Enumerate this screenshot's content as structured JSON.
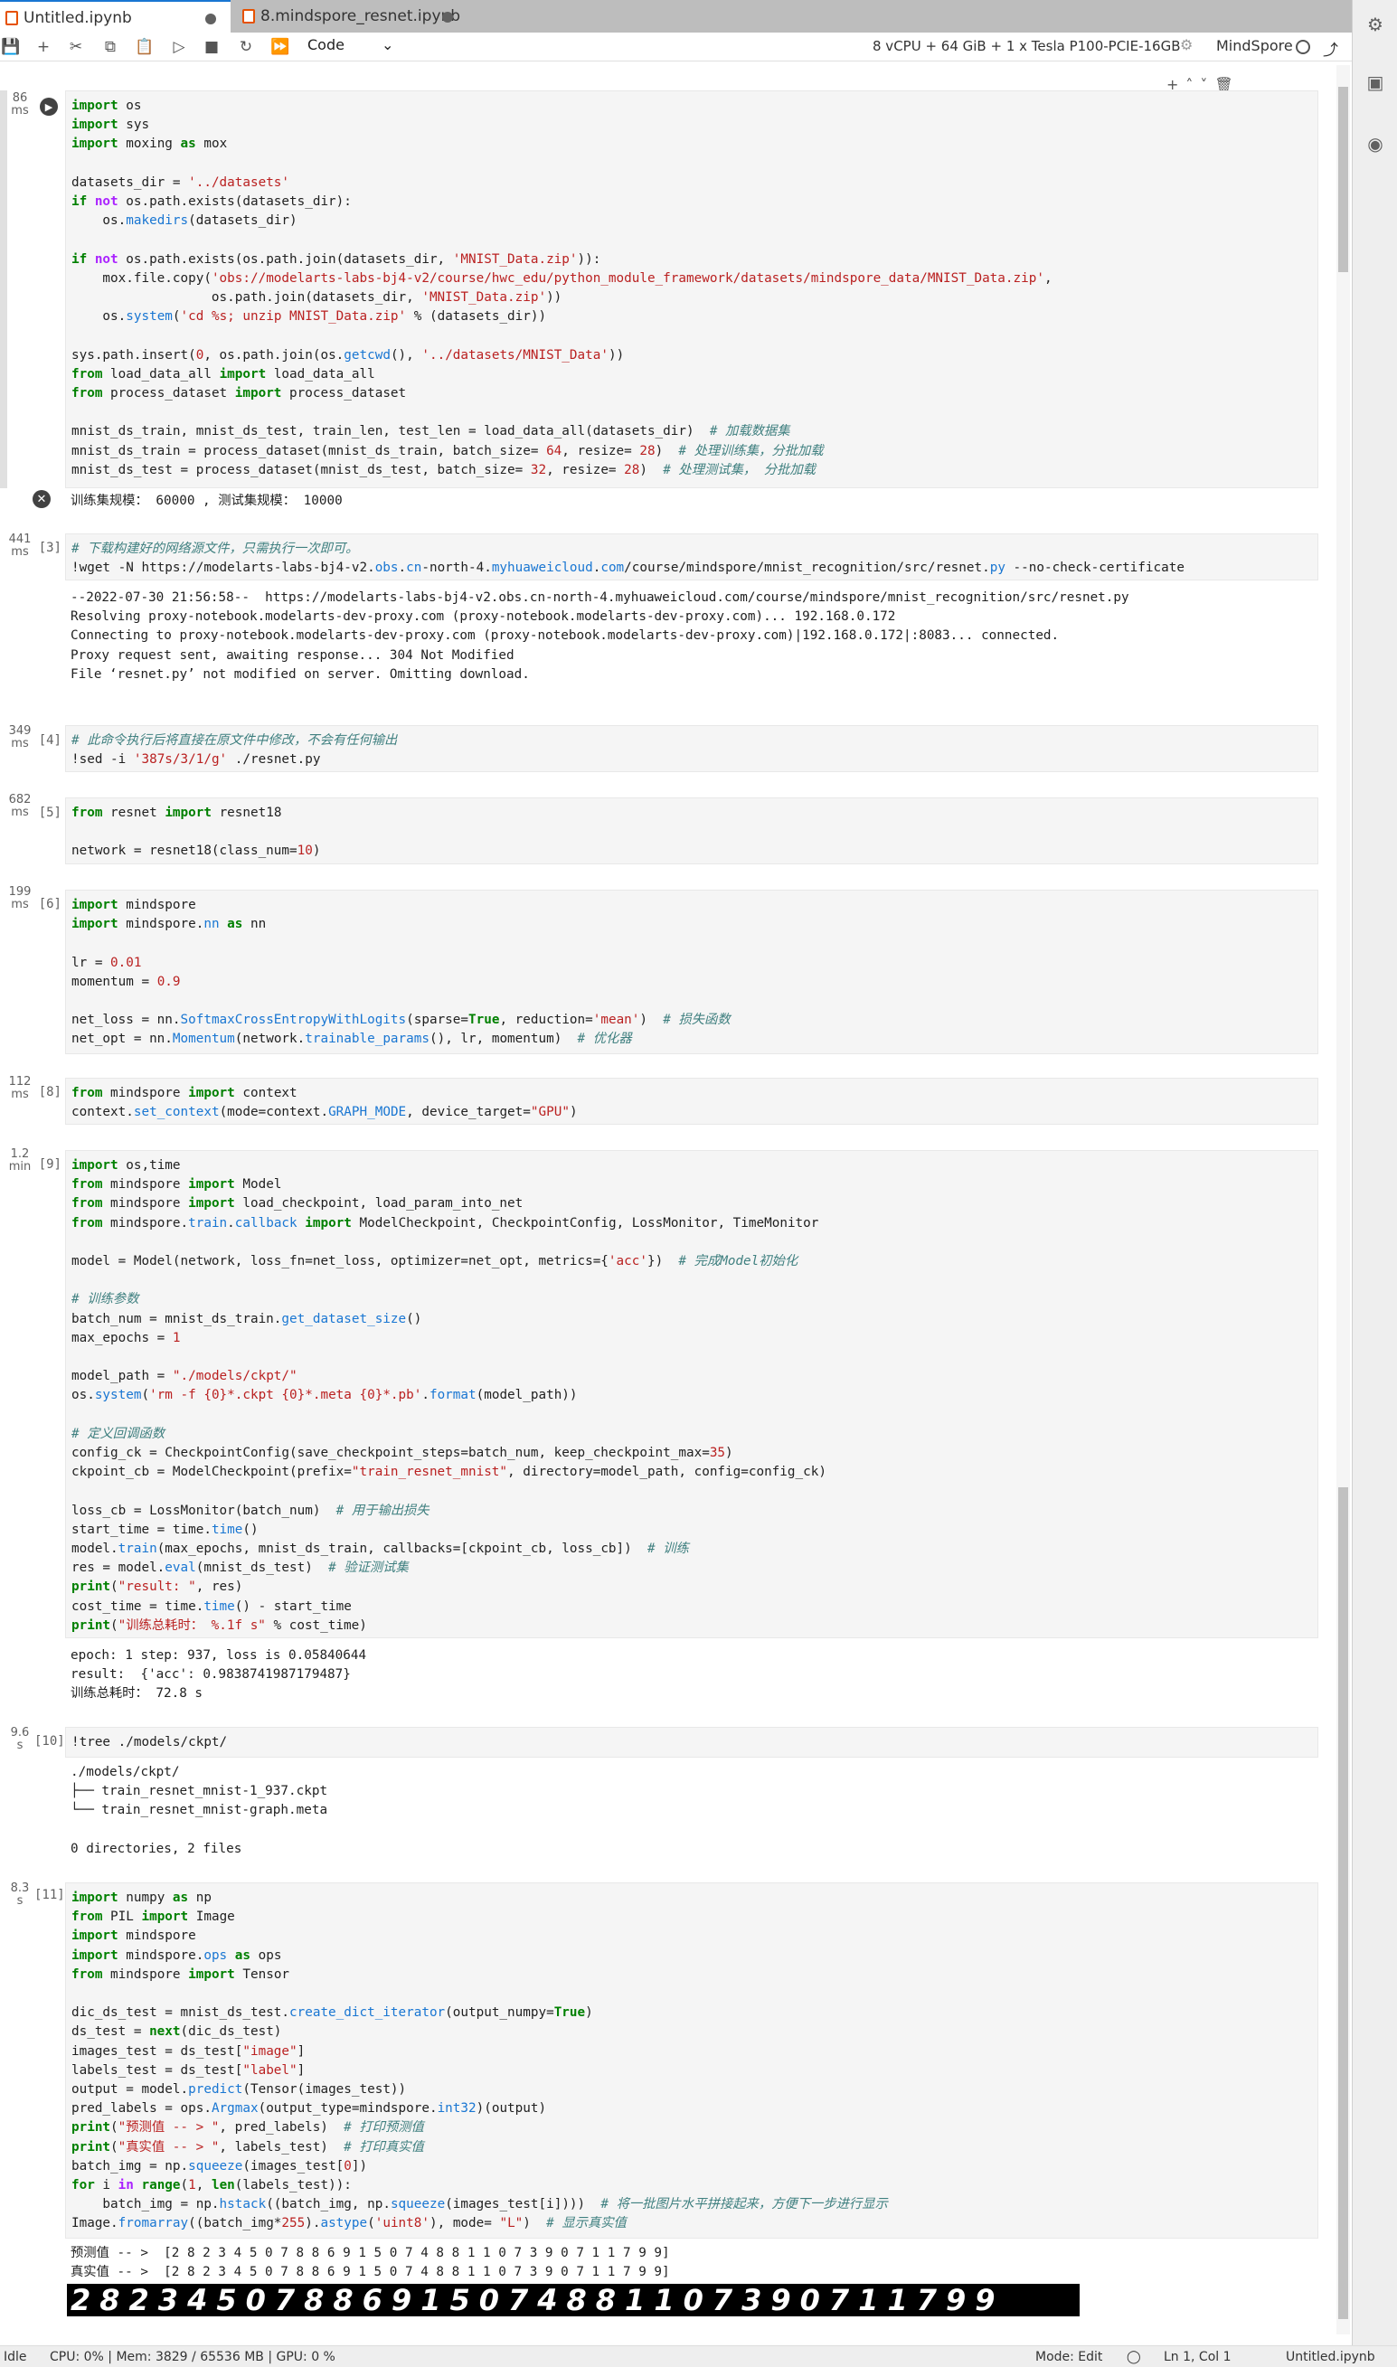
{
  "tabs": [
    {
      "label": "Untitled.ipynb",
      "active": true
    },
    {
      "label": "8.mindspore_resnet.ipynb",
      "active": false
    }
  ],
  "toolbar": {
    "cell_type": "Code",
    "kernel_info": "8 vCPU + 64 GiB + 1 x Tesla P100-PCIE-16GB",
    "kernel_name": "MindSpore"
  },
  "cells": [
    {
      "time": "86\nms",
      "prompt": "",
      "running": true
    },
    {
      "time": "441\nms",
      "prompt": "[3]"
    },
    {
      "time": "349\nms",
      "prompt": "[4]"
    },
    {
      "time": "682\nms",
      "prompt": "[5]"
    },
    {
      "time": "199\nms",
      "prompt": "[6]"
    },
    {
      "time": "112\nms",
      "prompt": "[8]"
    },
    {
      "time": "1.2\nmin",
      "prompt": "[9]"
    },
    {
      "time": "9.6\ns",
      "prompt": "[10]"
    },
    {
      "time": "8.3\ns",
      "prompt": "[11]"
    }
  ],
  "outputs": {
    "o1": "训练集规模： 60000 , 测试集规模： 10000",
    "o3_lines": [
      "--2022-07-30 21:56:58--  https://modelarts-labs-bj4-v2.obs.cn-north-4.myhuaweicloud.com/course/mindspore/mnist_recognition/src/resnet.py",
      "Resolving proxy-notebook.modelarts-dev-proxy.com (proxy-notebook.modelarts-dev-proxy.com)... 192.168.0.172",
      "Connecting to proxy-notebook.modelarts-dev-proxy.com (proxy-notebook.modelarts-dev-proxy.com)|192.168.0.172|:8083... connected.",
      "Proxy request sent, awaiting response... 304 Not Modified",
      "File ‘resnet.py’ not modified on server. Omitting download."
    ],
    "o9_lines": [
      "epoch: 1 step: 937, loss is 0.05840644",
      "result:  {'acc': 0.9838741987179487}",
      "训练总耗时： 72.8 s"
    ],
    "o10_lines": [
      "./models/ckpt/",
      "├── train_resnet_mnist-1_937.ckpt",
      "└── train_resnet_mnist-graph.meta",
      "",
      "0 directories, 2 files"
    ],
    "o11_lines": [
      "预测值 -- >  [2 8 2 3 4 5 0 7 8 8 6 9 1 5 0 7 4 8 8 1 1 0 7 3 9 0 7 1 1 7 9 9]",
      "真实值 -- >  [2 8 2 3 4 5 0 7 8 8 6 9 1 5 0 7 4 8 8 1 1 0 7 3 9 0 7 1 1 7 9 9]"
    ],
    "digits": "28234507886915074881107390711799"
  },
  "status": {
    "mode_idle": "Idle",
    "resources": "CPU: 0% | Mem: 3829 / 65536 MB | GPU: 0 %",
    "edit_mode": "Mode: Edit",
    "cursor": "Ln 1, Col 1",
    "file": "Untitled.ipynb"
  },
  "colors": {
    "accent": "#1976d2",
    "tab_bg": "#bdbdbd",
    "cell_bg": "#f5f5f5"
  }
}
